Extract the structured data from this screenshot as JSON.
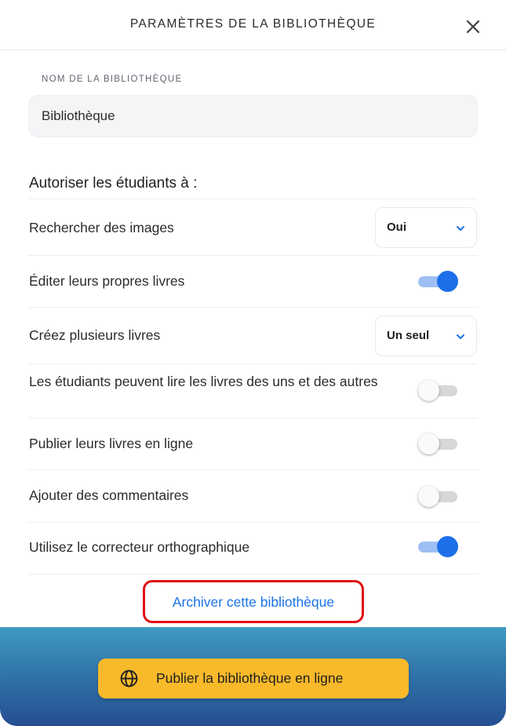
{
  "header": {
    "title": "PARAMÈTRES DE LA BIBLIOTHÈQUE",
    "close_icon": "close-icon"
  },
  "library_name": {
    "label": "NOM DE LA BIBLIOTHÈQUE",
    "value": "Bibliothèque"
  },
  "permissions": {
    "title": "Autoriser les étudiants à :",
    "rows": [
      {
        "label": "Rechercher des images",
        "control": "select",
        "value": "Oui"
      },
      {
        "label": "Éditer leurs propres livres",
        "control": "toggle",
        "on": true
      },
      {
        "label": "Créez plusieurs livres",
        "control": "select",
        "value": "Un seul"
      },
      {
        "label": "Les étudiants peuvent lire les livres des uns et des autres",
        "control": "toggle",
        "on": false
      },
      {
        "label": "Publier leurs livres en ligne",
        "control": "toggle",
        "on": false
      },
      {
        "label": "Ajouter des commentaires",
        "control": "toggle",
        "on": false
      },
      {
        "label": "Utilisez le correcteur orthographique",
        "control": "toggle",
        "on": true
      }
    ]
  },
  "archive": {
    "label": "Archiver cette bibliothèque"
  },
  "footer": {
    "publish_label": "Publier la bibliothèque en ligne",
    "publish_icon": "globe-icon"
  },
  "colors": {
    "accent": "#1c6fe8",
    "link": "#1a73e8",
    "highlight": "#e10f14",
    "publish_button": "#f8b92a"
  }
}
